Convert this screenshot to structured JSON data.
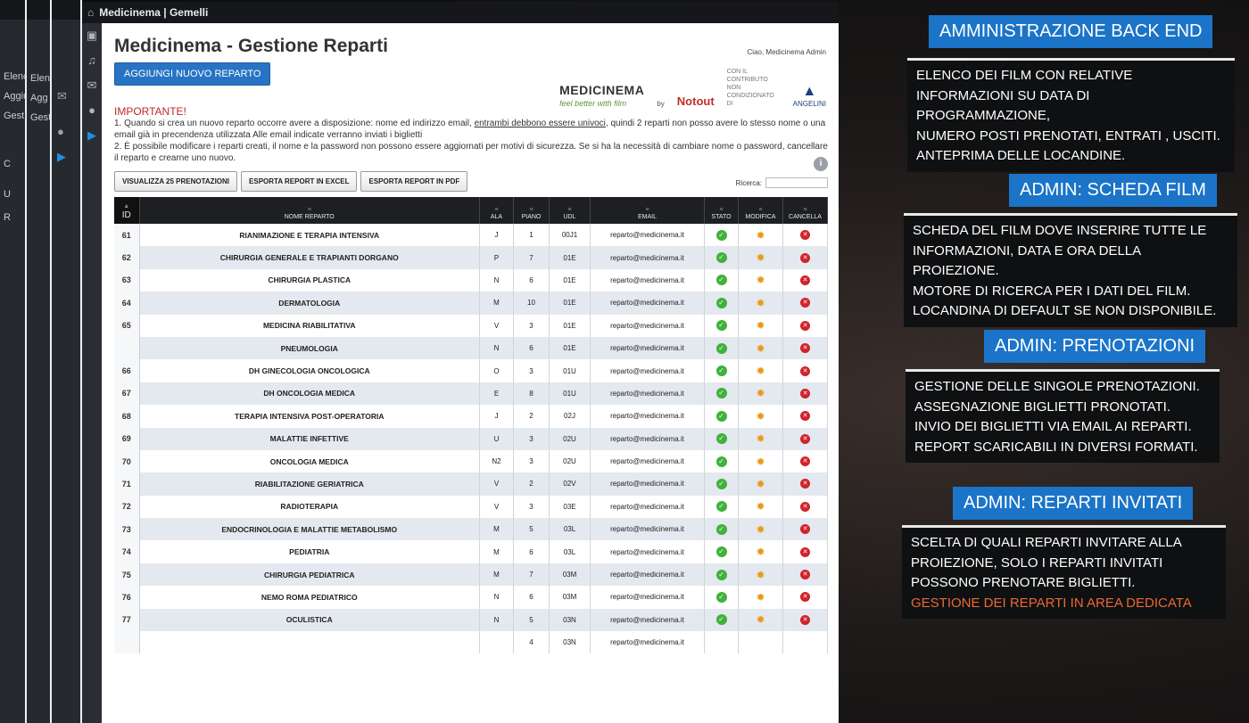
{
  "window": {
    "title": "Medicinema | Gemelli"
  },
  "background_stack": {
    "labels": [
      "Elenc",
      "Elen",
      "Aggiu",
      "Agg",
      "Gestic",
      "Gest",
      "C",
      "U",
      "R"
    ]
  },
  "page": {
    "title": "Medicinema - Gestione Reparti",
    "add_button": "AGGIUNGI NUOVO REPARTO",
    "greeting": "Ciao, Medicinema Admin",
    "logos": {
      "medicinema": "MEDICINEMA",
      "medicinema_tagline": "feel better with film",
      "by": "by",
      "notout": "Notout",
      "contribution": "CON IL CONTRIBUTO NON CONDIZIONATO DI",
      "angelini": "ANGELINI"
    },
    "important": "IMPORTANTE!",
    "note1a": "1. Quando si crea un nuovo reparto occorre avere a disposizione: nome ed indirizzo email,",
    "note1b": "entrambi debbono essere univoci",
    "note1c": ", quindi 2 reparti non posso avere lo stesso nome o una email già in precendenza utilizzata Alle email indicate verranno inviati i biglietti",
    "note2": "2. È possibile modificare i reparti creati, il nome e la password non possono essere aggiornati per motivi di sicurezza. Se si ha la necessità di cambiare nome o password, cancellare il reparto e crearne uno nuovo.",
    "toolbar": {
      "btn_view": "VISUALIZZA 25 PRENOTAZIONI",
      "btn_excel": "ESPORTA REPORT IN EXCEL",
      "btn_pdf": "ESPORTA REPORT IN PDF",
      "search_label": "Ricerca:"
    },
    "table": {
      "headers": {
        "id": "ID",
        "name": "NOME REPARTO",
        "ala": "ALA",
        "piano": "PIANO",
        "udl": "UDL",
        "email": "EMAIL",
        "stato": "STATO",
        "modifica": "MODIFICA",
        "cancella": "CANCELLA"
      },
      "rows": [
        {
          "id": "61",
          "name": "RIANIMAZIONE E TERAPIA INTENSIVA",
          "ala": "J",
          "piano": "1",
          "udl": "00J1",
          "email": "reparto@medicinema.it"
        },
        {
          "id": "62",
          "name": "CHIRURGIA GENERALE E TRAPIANTI DORGANO",
          "ala": "P",
          "piano": "7",
          "udl": "01E",
          "email": "reparto@medicinema.it"
        },
        {
          "id": "63",
          "name": "CHIRURGIA PLASTICA",
          "ala": "N",
          "piano": "6",
          "udl": "01E",
          "email": "reparto@medicinema.it"
        },
        {
          "id": "64",
          "name": "DERMATOLOGIA",
          "ala": "M",
          "piano": "10",
          "udl": "01E",
          "email": "reparto@medicinema.it"
        },
        {
          "id": "65",
          "name": "MEDICINA RIABILITATIVA",
          "ala": "V",
          "piano": "3",
          "udl": "01E",
          "email": "reparto@medicinema.it"
        },
        {
          "id": "",
          "name": "PNEUMOLOGIA",
          "ala": "N",
          "piano": "6",
          "udl": "01E",
          "email": "reparto@medicinema.it"
        },
        {
          "id": "66",
          "name": "DH GINECOLOGIA ONCOLOGICA",
          "ala": "O",
          "piano": "3",
          "udl": "01U",
          "email": "reparto@medicinema.it"
        },
        {
          "id": "67",
          "name": "DH ONCOLOGIA MEDICA",
          "ala": "E",
          "piano": "8",
          "udl": "01U",
          "email": "reparto@medicinema.it"
        },
        {
          "id": "68",
          "name": "TERAPIA INTENSIVA POST-OPERATORIA",
          "ala": "J",
          "piano": "2",
          "udl": "02J",
          "email": "reparto@medicinema.it"
        },
        {
          "id": "69",
          "name": "MALATTIE INFETTIVE",
          "ala": "U",
          "piano": "3",
          "udl": "02U",
          "email": "reparto@medicinema.it"
        },
        {
          "id": "70",
          "name": "ONCOLOGIA MEDICA",
          "ala": "N2",
          "piano": "3",
          "udl": "02U",
          "email": "reparto@medicinema.it"
        },
        {
          "id": "71",
          "name": "RIABILITAZIONE GERIATRICA",
          "ala": "V",
          "piano": "2",
          "udl": "02V",
          "email": "reparto@medicinema.it"
        },
        {
          "id": "72",
          "name": "RADIOTERAPIA",
          "ala": "V",
          "piano": "3",
          "udl": "03E",
          "email": "reparto@medicinema.it"
        },
        {
          "id": "73",
          "name": "ENDOCRINOLOGIA E MALATTIE METABOLISMO",
          "ala": "M",
          "piano": "5",
          "udl": "03L",
          "email": "reparto@medicinema.it"
        },
        {
          "id": "74",
          "name": "PEDIATRIA",
          "ala": "M",
          "piano": "6",
          "udl": "03L",
          "email": "reparto@medicinema.it"
        },
        {
          "id": "75",
          "name": "CHIRURGIA PEDIATRICA",
          "ala": "M",
          "piano": "7",
          "udl": "03M",
          "email": "reparto@medicinema.it"
        },
        {
          "id": "76",
          "name": "NEMO ROMA PEDIATRICO",
          "ala": "N",
          "piano": "6",
          "udl": "03M",
          "email": "reparto@medicinema.it"
        },
        {
          "id": "77",
          "name": "OCULISTICA",
          "ala": "N",
          "piano": "5",
          "udl": "03N",
          "email": "reparto@medicinema.it"
        }
      ],
      "tail_row": {
        "piano": "4",
        "udl": "03N",
        "email": "reparto@medicinema.it"
      }
    }
  },
  "panels": [
    {
      "header": "AMMINISTRAZIONE BACK END",
      "lines": [
        "ELENCO DEI FILM CON RELATIVE",
        "INFORMAZIONI SU DATA DI PROGRAMMAZIONE,",
        "NUMERO POSTI PRENOTATI, ENTRATI , USCITI.",
        "ANTEPRIMA DELLE LOCANDINE."
      ]
    },
    {
      "header": "ADMIN: SCHEDA FILM",
      "lines": [
        "SCHEDA DEL FILM DOVE INSERIRE TUTTE LE",
        "INFORMAZIONI, DATA E ORA DELLA PROIEZIONE.",
        "MOTORE DI RICERCA PER I DATI DEL FILM.",
        "LOCANDINA DI DEFAULT SE NON DISPONIBILE."
      ]
    },
    {
      "header": "ADMIN: PRENOTAZIONI",
      "lines": [
        "GESTIONE DELLE SINGOLE PRENOTAZIONI.",
        "ASSEGNAZIONE BIGLIETTI PRONOTATI.",
        "INVIO DEI BIGLIETTI VIA EMAIL AI REPARTI.",
        "REPORT SCARICABILI IN DIVERSI FORMATI."
      ]
    },
    {
      "header": "ADMIN: REPARTI INVITATI",
      "lines": [
        "SCELTA DI QUALI REPARTI INVITARE ALLA",
        "PROIEZIONE, SOLO I REPARTI INVITATI",
        "POSSONO PRENOTARE BIGLIETTI."
      ],
      "accent_line": "GESTIONE DEI REPARTI IN AREA DEDICATA"
    }
  ],
  "colors": {
    "accent_blue": "#1b74c8",
    "ok_green": "#3fb23a",
    "gear_orange": "#e89a15",
    "delete_red": "#d0232a",
    "accent_orange": "#e96a33"
  },
  "icons": {
    "stato": "check-icon",
    "modifica": "gear-icon",
    "cancella": "close-icon",
    "home": "home-icon"
  }
}
